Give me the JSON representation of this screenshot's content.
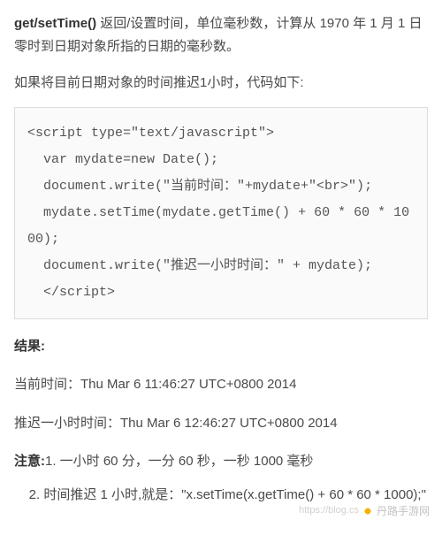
{
  "intro": {
    "method": "get/setTime()",
    "rest": " 返回/设置时间，单位毫秒数，计算从 1970 年 1 月 1 日零时到日期对象所指的日期的毫秒数。"
  },
  "lead2": "如果将目前日期对象的时间推迟1小时，代码如下:",
  "code": "<script type=\"text/javascript\">\n  var mydate=new Date();\n  document.write(\"当前时间：\"+mydate+\"<br>\");\n  mydate.setTime(mydate.getTime() + 60 * 60 * 1000);\n  document.write(\"推迟一小时时间：\" + mydate);\n  </script>",
  "result_heading": "结果:",
  "result1": "当前时间：Thu Mar 6 11:46:27 UTC+0800 2014",
  "result2": "推迟一小时时间：Thu Mar 6 12:46:27 UTC+0800 2014",
  "note_label": "注意:",
  "note1_rest": "1. 一小时 60 分，一分 60 秒，一秒 1000 毫秒",
  "note2": "2. 时间推迟 1 小时,就是：\"x.setTime(x.getTime() + 60 * 60 * 1000);\"",
  "watermark": {
    "url_faint": "https://blog.cs",
    "site": "丹路手游网"
  }
}
